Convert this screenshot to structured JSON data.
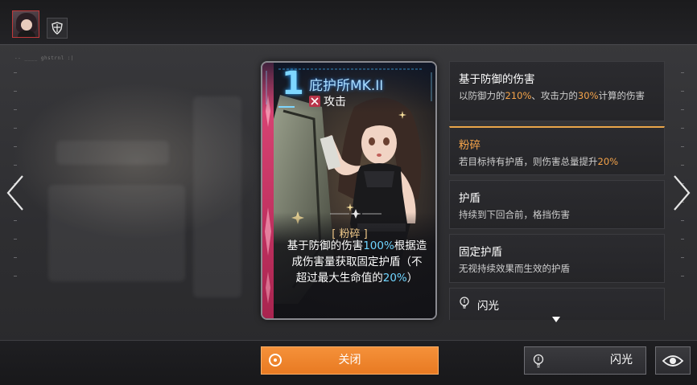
{
  "header": {
    "debug_label": "-- ____ ghstrnl :|"
  },
  "card": {
    "cost": "1",
    "name": "庇护所MK.II",
    "type": "攻击",
    "keyword": "[ 粉碎 ]",
    "desc_parts": [
      "基于防御的伤害",
      "100%",
      "根据造成伤害量获取固定护盾（不超过最大生命值的",
      "20%",
      "）"
    ]
  },
  "skills": [
    {
      "title": "基于防御的伤害",
      "desc_parts": [
        "以防御力的",
        "210%",
        "、攻击力的",
        "30%",
        "计算的伤害"
      ]
    },
    {
      "title": "粉碎",
      "desc_parts": [
        "若目标持有护盾，则伤害总量提升",
        "20%"
      ]
    },
    {
      "title": "护盾",
      "desc": "持续到下回合前，格挡伤害"
    },
    {
      "title": "固定护盾",
      "desc": "无视持续效果而生效的护盾"
    },
    {
      "title": "闪光",
      "icon": "lightbulb-icon"
    }
  ],
  "buttons": {
    "close": "关闭",
    "flash": "闪光"
  },
  "colors": {
    "accent_orange": "#f6a44a",
    "close_button": "#f08a32",
    "card_stripe": "#d43e6e",
    "highlight_cyan": "#6fd5ff"
  }
}
